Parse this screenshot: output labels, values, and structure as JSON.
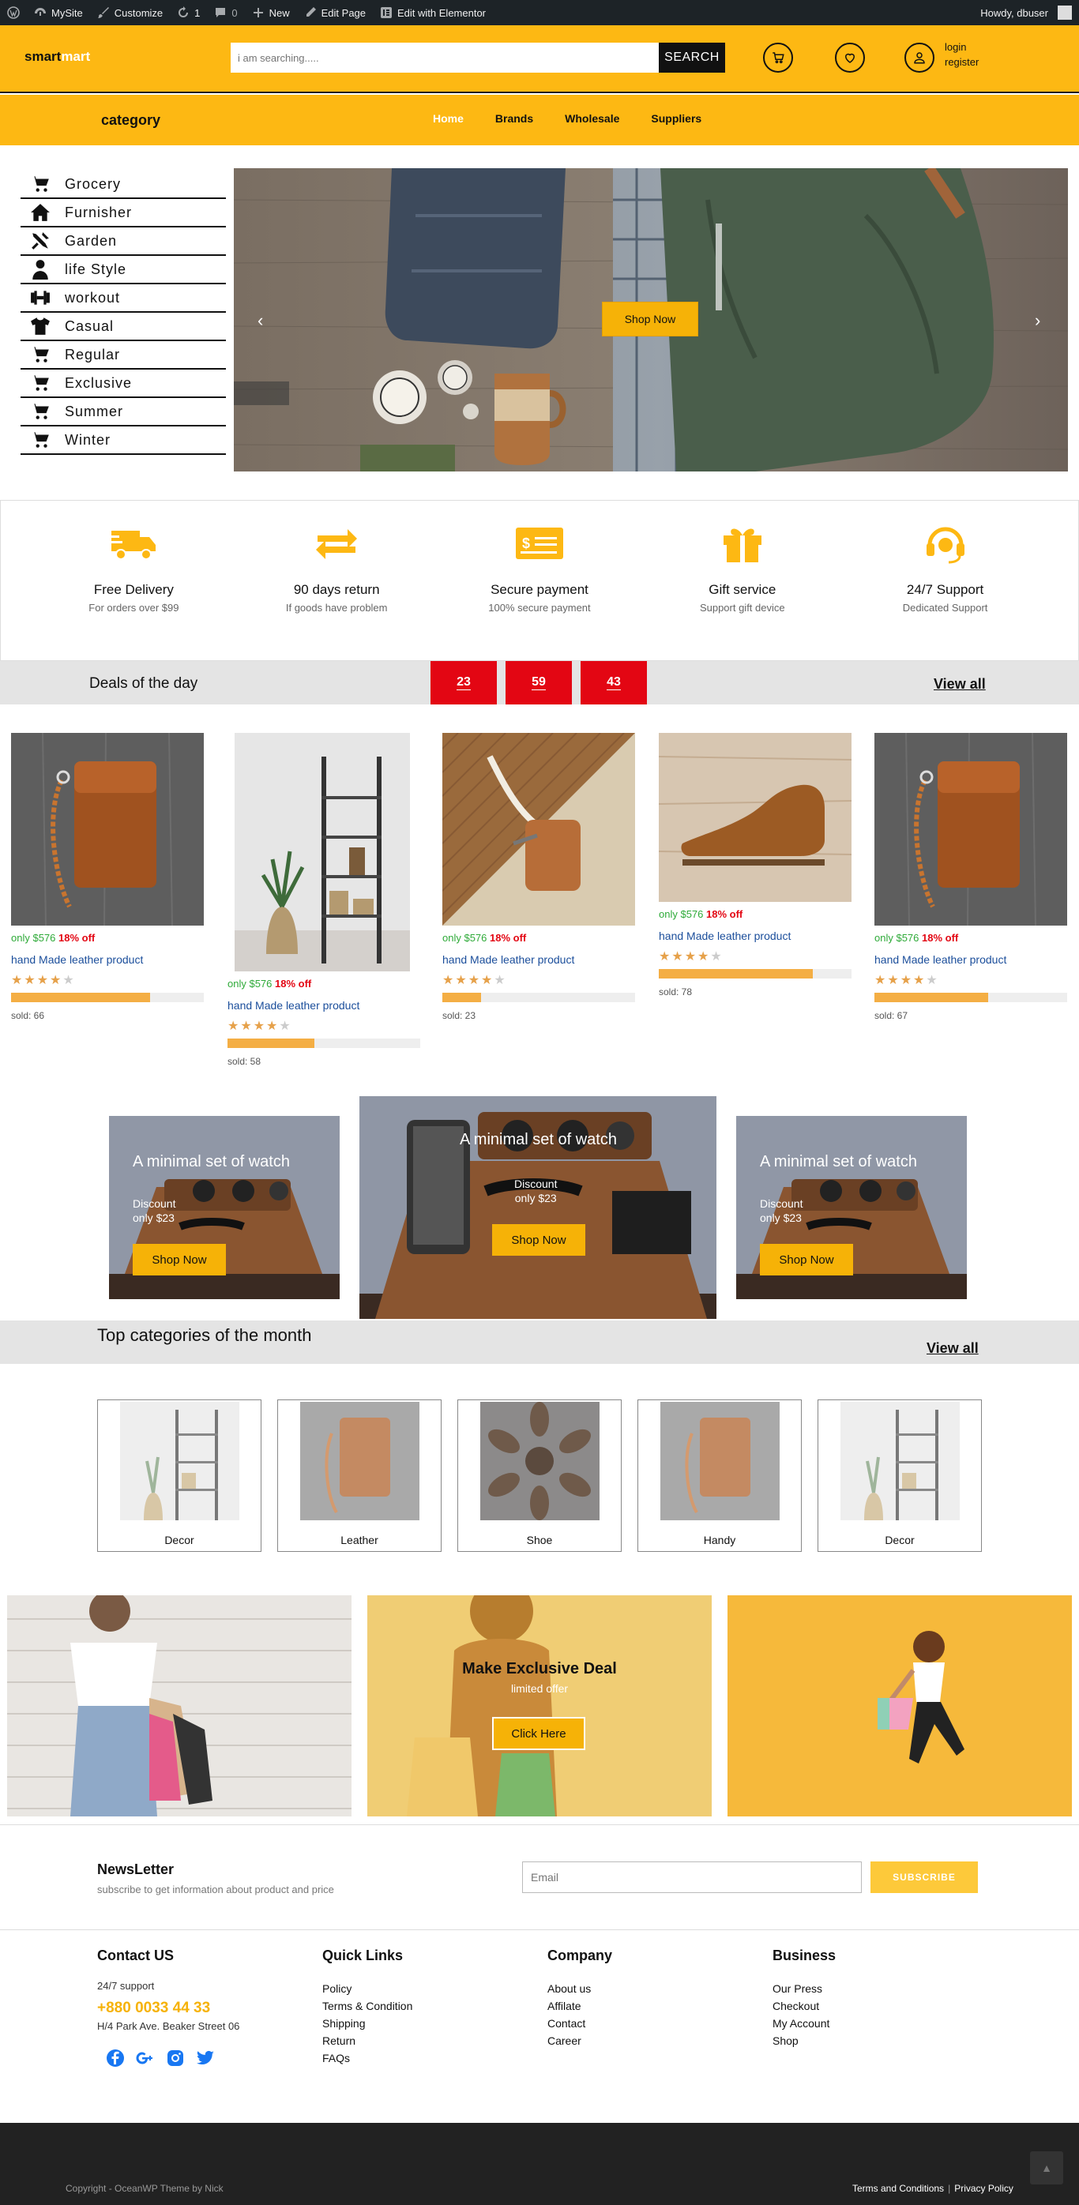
{
  "admin_bar": {
    "items": [
      {
        "icon": "wordpress-icon",
        "label": ""
      },
      {
        "icon": "dashboard-icon",
        "label": "MySite"
      },
      {
        "icon": "brush-icon",
        "label": "Customize"
      },
      {
        "icon": "refresh-icon",
        "label": "1"
      },
      {
        "icon": "comment-icon",
        "label": "0"
      },
      {
        "icon": "plus-icon",
        "label": "New"
      },
      {
        "icon": "pencil-icon",
        "label": "Edit Page"
      },
      {
        "icon": "elementor-icon",
        "label": "Edit with Elementor"
      }
    ],
    "howdy": "Howdy, dbuser"
  },
  "header": {
    "logo_part1": "smart",
    "logo_part2": "mart",
    "search_placeholder": "i am searching.....",
    "search_button": "SEARCH",
    "login": "login",
    "register": "register"
  },
  "nav": {
    "category_label": "category",
    "menu": [
      "Home",
      "Brands",
      "Wholesale",
      "Suppliers"
    ]
  },
  "sidebar": {
    "items": [
      {
        "label": "Grocery",
        "icon": "cart-icon"
      },
      {
        "label": "Furnisher",
        "icon": "home-icon"
      },
      {
        "label": "Garden",
        "icon": "tools-icon"
      },
      {
        "label": "life Style",
        "icon": "user-tie-icon"
      },
      {
        "label": "workout",
        "icon": "dumbbell-icon"
      },
      {
        "label": "Casual",
        "icon": "tshirt-icon"
      },
      {
        "label": "Regular",
        "icon": "cart-icon"
      },
      {
        "label": "Exclusive",
        "icon": "cart-icon"
      },
      {
        "label": "Summer",
        "icon": "cart-icon"
      },
      {
        "label": "Winter",
        "icon": "cart-icon"
      }
    ]
  },
  "hero": {
    "button": "Shop Now"
  },
  "features": [
    {
      "title": "Free Delivery",
      "sub": "For orders over $99",
      "icon": "truck-icon"
    },
    {
      "title": "90 days return",
      "sub": "If goods have problem",
      "icon": "exchange-icon"
    },
    {
      "title": "Secure payment",
      "sub": "100% secure payment",
      "icon": "card-icon"
    },
    {
      "title": "Gift service",
      "sub": "Support gift device",
      "icon": "gift-icon"
    },
    {
      "title": "24/7 Support",
      "sub": "Dedicated Support",
      "icon": "headset-icon"
    }
  ],
  "deals": {
    "title": "Deals of the day",
    "timer": [
      "23",
      "59",
      "43"
    ],
    "view_all": "View all",
    "accent": "#e30613"
  },
  "products": [
    {
      "price": "only $576",
      "off": "18% off",
      "name": "hand Made leather product",
      "rating": 4,
      "progress": 0.72,
      "sold": "sold: 66"
    },
    {
      "price": "only $576",
      "off": "18% off",
      "name": "hand Made leather product",
      "rating": 4,
      "progress": 0.45,
      "sold": "sold: 58"
    },
    {
      "price": "only $576",
      "off": "18% off",
      "name": "hand Made leather product",
      "rating": 4,
      "progress": 0.2,
      "sold": "sold: 23"
    },
    {
      "price": "only $576",
      "off": "18% off",
      "name": "hand Made leather product",
      "rating": 4,
      "progress": 0.8,
      "sold": "sold: 78"
    },
    {
      "price": "only $576",
      "off": "18% off",
      "name": "hand Made leather product",
      "rating": 4,
      "progress": 0.59,
      "sold": "sold: 67"
    }
  ],
  "watch_banners": [
    {
      "title": "A minimal set of watch",
      "disc1": "Discount",
      "disc2": "only $23",
      "button": "Shop Now"
    },
    {
      "title": "A minimal set of watch",
      "disc1": "Discount",
      "disc2": "only $23",
      "button": "Shop Now"
    },
    {
      "title": "A minimal set of watch",
      "disc1": "Discount",
      "disc2": "only $23",
      "button": "Shop Now"
    }
  ],
  "top_categories": {
    "title": "Top categories of the month",
    "view_all": "View all",
    "items": [
      "Decor",
      "Leather",
      "Shoe",
      "Handy",
      "Decor"
    ]
  },
  "promo": {
    "title": "Make Exclusive Deal",
    "sub": "limited offer",
    "button": "Click Here"
  },
  "newsletter": {
    "title": "NewsLetter",
    "sub": "subscribe to get information about product and price",
    "placeholder": "Email",
    "button": "SUBSCRIBE"
  },
  "footer": {
    "contact": {
      "title": "Contact US",
      "support": "24/7 support",
      "phone": "+880 0033 44 33",
      "address": "H/4 Park Ave. Beaker Street 06"
    },
    "quick_links": {
      "title": "Quick Links",
      "links": [
        "Policy",
        "Terms & Condition",
        "Shipping",
        "Return",
        "FAQs"
      ]
    },
    "company": {
      "title": "Company",
      "links": [
        "About us",
        "Affilate",
        "Contact",
        "Career"
      ]
    },
    "business": {
      "title": "Business",
      "links": [
        "Our Press",
        "Checkout",
        "My Account",
        "Shop"
      ]
    },
    "social": [
      "facebook-icon",
      "google-plus-icon",
      "instagram-icon",
      "twitter-icon"
    ],
    "copyright": "Copyright - OceanWP Theme by Nick",
    "terms": "Terms and Conditions",
    "separator": "|",
    "privacy": "Privacy Policy"
  },
  "colors": {
    "brand": "#fdb813",
    "dark": "#111111",
    "link": "#1b4e9b",
    "green": "#2eaa38"
  }
}
